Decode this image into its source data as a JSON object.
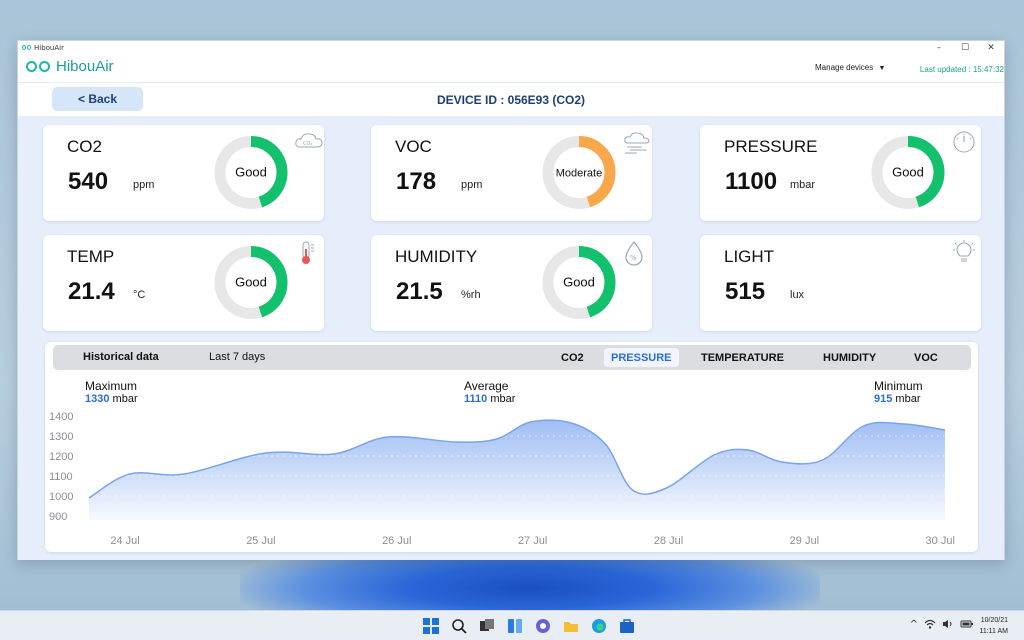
{
  "window": {
    "title": "HibouAir",
    "minimize": "–",
    "maximize": "☐",
    "close": "✕"
  },
  "header": {
    "logo_text": "HibouAir",
    "manage_label": "Manage devices",
    "last_updated": "Last updated : 15:47:32"
  },
  "topbar": {
    "back_label": "< Back",
    "device_id": "DEVICE ID : 056E93 (CO2)"
  },
  "cards": [
    {
      "name": "CO2",
      "value": "540",
      "unit": "ppm",
      "status": "Good",
      "level": 0.45,
      "color": "#13c06c",
      "icon": "co2-cloud-icon"
    },
    {
      "name": "VOC",
      "value": "178",
      "unit": "ppm",
      "status": "Moderate",
      "level": 0.45,
      "color": "#f8a84a",
      "icon": "voc-cloud-icon"
    },
    {
      "name": "PRESSURE",
      "value": "1100",
      "unit": "mbar",
      "status": "Good",
      "level": 0.45,
      "color": "#13c06c",
      "icon": "barometer-icon"
    },
    {
      "name": "TEMP",
      "value": "21.4",
      "unit": "°C",
      "status": "Good",
      "level": 0.45,
      "color": "#13c06c",
      "icon": "thermometer-icon"
    },
    {
      "name": "HUMIDITY",
      "value": "21.5",
      "unit": "%rh",
      "status": "Good",
      "level": 0.45,
      "color": "#13c06c",
      "icon": "humidity-drop-icon"
    },
    {
      "name": "LIGHT",
      "value": "515",
      "unit": "lux",
      "status": "",
      "level": 0,
      "color": "#13c06c",
      "icon": "light-bulb-icon"
    }
  ],
  "history": {
    "title": "Historical data",
    "range": "Last 7 days",
    "tabs": [
      "CO2",
      "PRESSURE",
      "TEMPERATURE",
      "HUMIDITY",
      "VOC"
    ],
    "active_tab": "PRESSURE",
    "max_label": "Maximum",
    "max_value": "1330",
    "max_unit": "mbar",
    "avg_label": "Average",
    "avg_value": "1110",
    "avg_unit": "mbar",
    "min_label": "Minimum",
    "min_value": "915",
    "min_unit": "mbar"
  },
  "chart_data": {
    "type": "area",
    "y_ticks": [
      1400,
      1300,
      1200,
      1100,
      1000,
      900
    ],
    "ylim": [
      880,
      1420
    ],
    "x_labels": [
      "24 Jul",
      "25 Jul",
      "26 Jul",
      "27 Jul",
      "28 Jul",
      "29 Jul",
      "30 Jul"
    ],
    "x": [
      0,
      0.3,
      0.7,
      1.3,
      1.8,
      2.2,
      2.7,
      3.0,
      3.25,
      3.55,
      3.8,
      4.0,
      4.25,
      4.6,
      4.85,
      5.1,
      5.4,
      5.7,
      6.0,
      6.3
    ],
    "y": [
      990,
      1110,
      1110,
      1215,
      1210,
      1295,
      1270,
      1285,
      1370,
      1365,
      1260,
      1030,
      1040,
      1205,
      1230,
      1170,
      1180,
      1350,
      1360,
      1330
    ],
    "grid": false,
    "fill_color": "#8fb2f1",
    "line_color": "#7aa3ee"
  },
  "taskbar": {
    "icons": [
      "windows-start-icon",
      "search-icon",
      "task-view-icon",
      "widgets-icon",
      "teams-chat-icon",
      "file-explorer-icon",
      "edge-browser-icon",
      "store-icon"
    ],
    "tray_chevron": "^",
    "date": "10/20/21",
    "time": "11:11 AM"
  }
}
